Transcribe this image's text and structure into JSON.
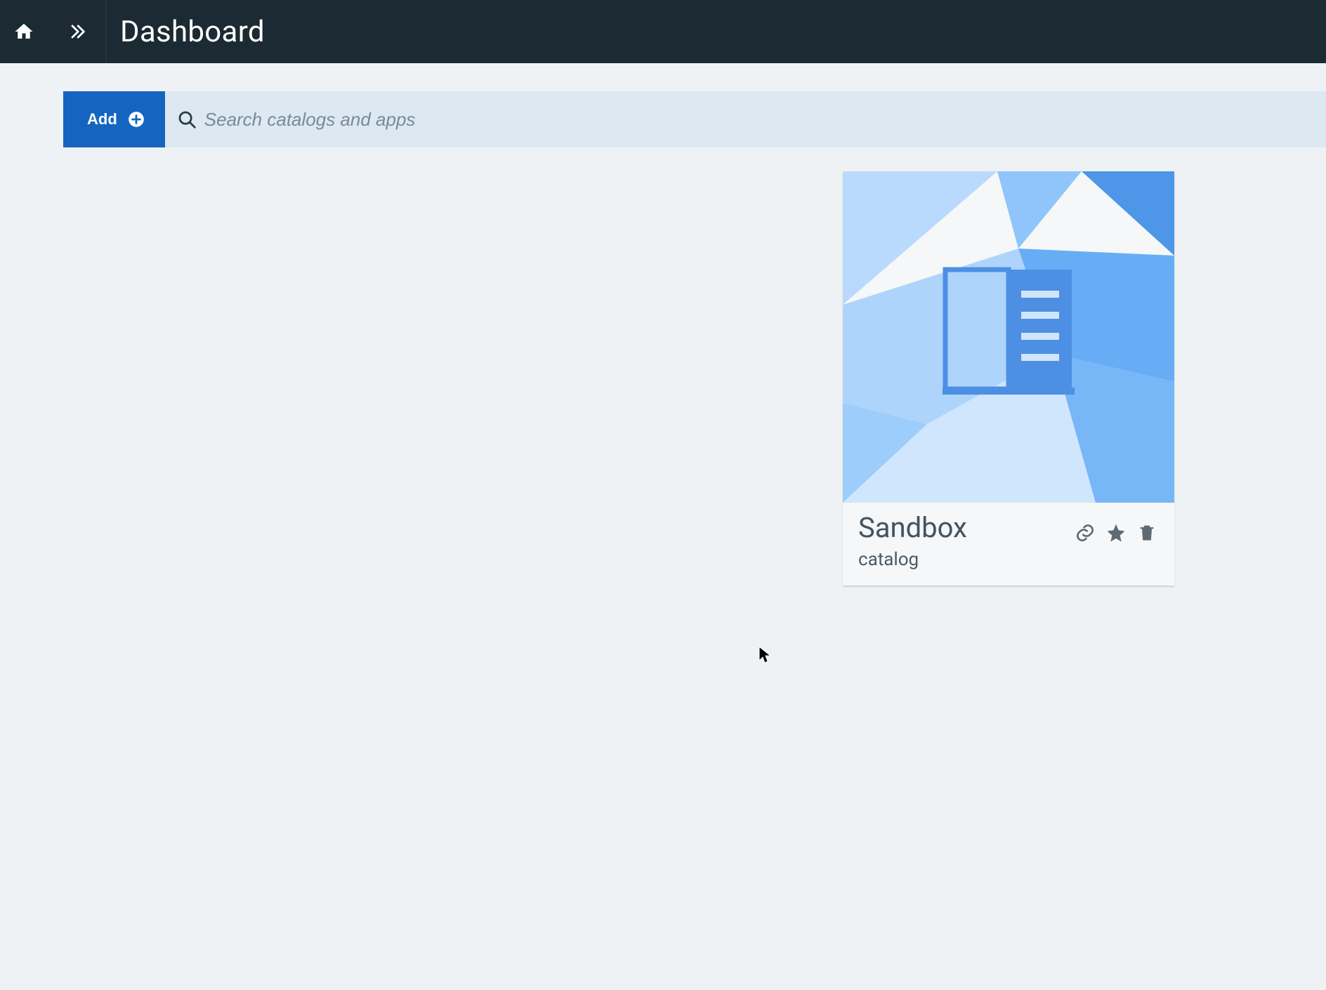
{
  "header": {
    "title": "Dashboard"
  },
  "toolbar": {
    "add_label": "Add",
    "search_placeholder": "Search catalogs and apps"
  },
  "cards": [
    {
      "title": "Sandbox",
      "subtitle": "catalog"
    }
  ],
  "icons": {
    "home": "home-icon",
    "expand": "chevron-double-right-icon",
    "plus": "plus-circle-icon",
    "search": "search-icon",
    "link": "link-icon",
    "star": "star-icon",
    "trash": "trash-icon",
    "catalog": "book-open-icon"
  },
  "colors": {
    "header_bg": "#1b2a33",
    "primary": "#1565c0",
    "toolbar_bg": "#dce8f2",
    "page_bg": "#eef2f5",
    "thumb_a": "#aed4fb",
    "thumb_b": "#67adf6",
    "thumb_c": "#4d96e8",
    "thumb_d": "#cfe6fd"
  }
}
